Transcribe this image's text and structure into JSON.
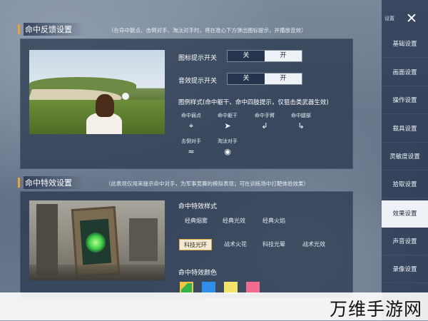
{
  "feedback_section": {
    "title": "命中反馈设置",
    "note": "（在命中躯点、击倒对手、淘汰对手时，将在准心下方弹出图标提示，并播放音效）",
    "icon_toggle_label": "图标提示开关",
    "sound_toggle_label": "音效提示开关",
    "off_label": "关",
    "on_label": "开",
    "icon_toggle_value": "开",
    "sound_toggle_value": "开",
    "legend_title": "图例样式(命中躯干、命中四肢提示，仅狙击类武器生效)",
    "legend_items": [
      {
        "label": "命中弱点",
        "icon": "crosshair-icon",
        "glyph": "⌖"
      },
      {
        "label": "命中躯干",
        "icon": "torso-icon",
        "glyph": "➤"
      },
      {
        "label": "命中手臂",
        "icon": "arm-icon",
        "glyph": "↲"
      },
      {
        "label": "命中腿部",
        "icon": "leg-icon",
        "glyph": "↳"
      },
      {
        "label": "击倒对手",
        "icon": "knockdown-icon",
        "glyph": "≈"
      },
      {
        "label": "淘汰对手",
        "icon": "eliminate-icon",
        "glyph": "◉"
      }
    ]
  },
  "effect_section": {
    "title": "命中特效设置",
    "note": "（此表现仅用来提示命中对手，为军事竞赛的模拟表现；可在训练场中打靶体验效果）",
    "style_title": "命中特效样式",
    "styles": [
      "经典烟雾",
      "经典光效",
      "经典火焰",
      "科技光环",
      "战术火花",
      "科技光晕",
      "战术光效"
    ],
    "selected_style": "科技光环",
    "color_title": "命中特效颜色",
    "colors": [
      "#35b24a",
      "#2f8fe8",
      "#f3e36a",
      "#f06b8e"
    ],
    "selected_color_index": 0
  },
  "sidebar": {
    "top_label": "设置",
    "close_glyph": "✕",
    "items": [
      "基础设置",
      "画面设置",
      "操作设置",
      "载具设置",
      "灵敏度设置",
      "拾取设置",
      "效果设置",
      "声音设置",
      "录像设置"
    ],
    "active_item": "效果设置"
  },
  "watermark": "万维手游网",
  "accent_color": "#e8a23c"
}
